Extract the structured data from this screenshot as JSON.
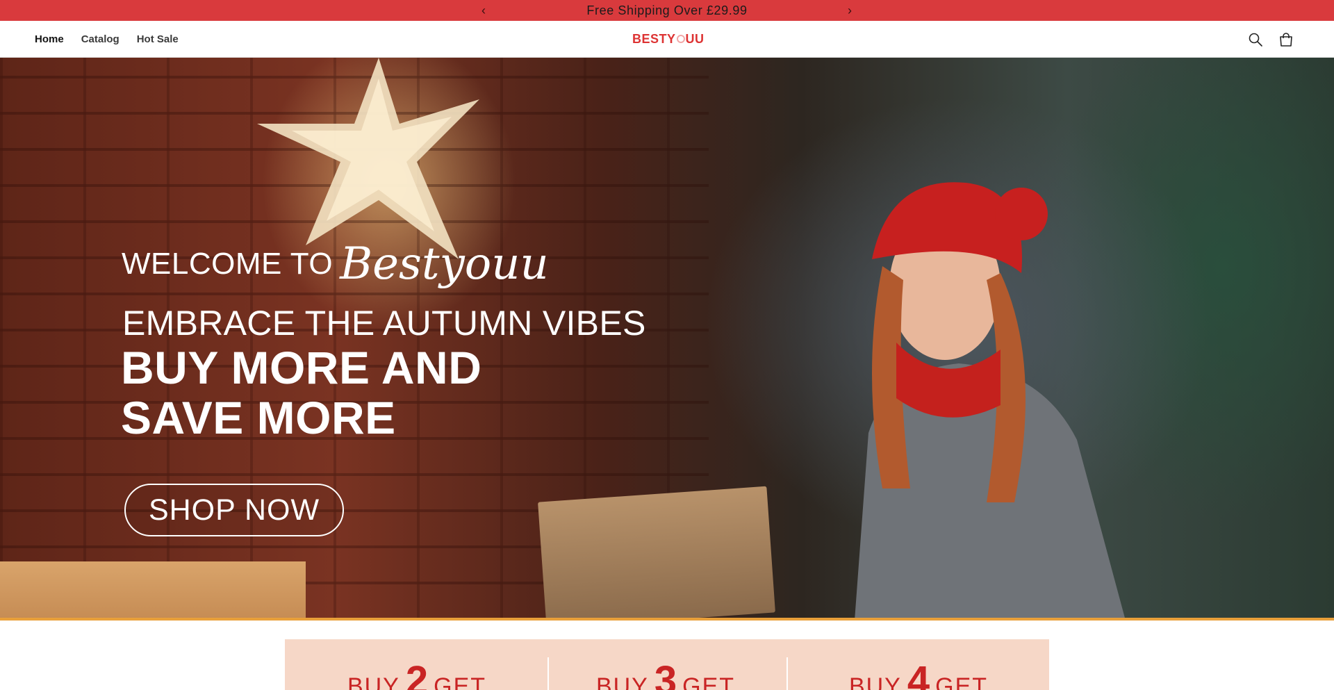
{
  "announcement": {
    "message": "Free Shipping Over £29.99",
    "prev_glyph": "‹",
    "next_glyph": "›"
  },
  "header": {
    "nav": [
      {
        "label": "Home",
        "active": true
      },
      {
        "label": "Catalog",
        "active": false
      },
      {
        "label": "Hot Sale",
        "active": false
      }
    ],
    "logo": {
      "part1": "BESTY",
      "part2": "UU"
    },
    "icons": [
      "search-icon",
      "cart-icon"
    ]
  },
  "hero": {
    "welcome": "WELCOME TO",
    "brand_script": "Bestyouu",
    "line1": "EMBRACE THE AUTUMN VIBES",
    "line2": "BUY MORE AND",
    "line3": "SAVE MORE",
    "cta": "SHOP NOW"
  },
  "promo": {
    "tiles": [
      {
        "prefix": "BUY",
        "number": "2",
        "suffix": "GET"
      },
      {
        "prefix": "BUY",
        "number": "3",
        "suffix": "GET"
      },
      {
        "prefix": "BUY",
        "number": "4",
        "suffix": "GET"
      }
    ]
  },
  "colors": {
    "announcement_bg": "#d93a3d",
    "logo_red": "#dd3333",
    "promo_bg": "#f6d7c7",
    "promo_text": "#c92424"
  }
}
